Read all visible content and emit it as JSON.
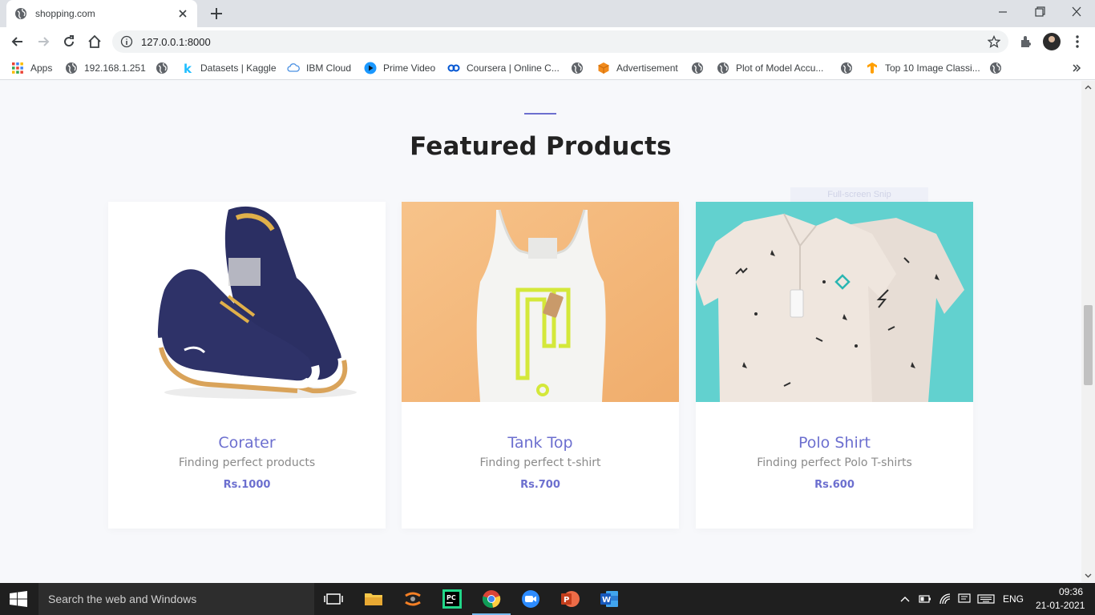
{
  "browser": {
    "tab_title": "shopping.com",
    "url": "127.0.0.1:8000",
    "bookmarks": [
      {
        "label": "Apps",
        "icon": "apps-grid-icon"
      },
      {
        "label": "192.168.1.251",
        "icon": "globe-icon"
      },
      {
        "label": "",
        "icon": "globe-icon"
      },
      {
        "label": "Datasets | Kaggle",
        "icon": "kaggle-icon"
      },
      {
        "label": "IBM Cloud",
        "icon": "cloud-icon"
      },
      {
        "label": "Prime Video",
        "icon": "prime-video-icon"
      },
      {
        "label": "Coursera | Online C...",
        "icon": "coursera-icon"
      },
      {
        "label": "",
        "icon": "globe-icon"
      },
      {
        "label": "Advertisement",
        "icon": "cube-icon"
      },
      {
        "label": "",
        "icon": "globe-icon"
      },
      {
        "label": "Plot of Model Accu...",
        "icon": "globe-icon"
      },
      {
        "label": "",
        "icon": "globe-icon"
      },
      {
        "label": "Top 10 Image Classi...",
        "icon": "tensorflow-icon"
      },
      {
        "label": "",
        "icon": "globe-icon"
      }
    ]
  },
  "page": {
    "section_title": "Featured Products",
    "snip_overlay": "Full-screen Snip",
    "products": [
      {
        "name": "Corater",
        "description": "Finding perfect products",
        "price": "Rs.1000",
        "image": "sneaker-photo",
        "bg": "#ffffff"
      },
      {
        "name": "Tank Top",
        "description": "Finding perfect t-shirt",
        "price": "Rs.700",
        "image": "tank-top-photo",
        "bg": "#f3bf85"
      },
      {
        "name": "Polo Shirt",
        "description": "Finding perfect Polo T-shirts",
        "price": "Rs.600",
        "image": "polo-shirt-photo",
        "bg": "#62d1cf"
      }
    ]
  },
  "taskbar": {
    "search_placeholder": "Search the web and Windows",
    "language": "ENG",
    "time": "09:36",
    "date": "21-01-2021"
  },
  "colors": {
    "accent": "#6c6fcf",
    "page_bg": "#f7f8fb",
    "taskbar_bg": "#1f1f1f"
  }
}
